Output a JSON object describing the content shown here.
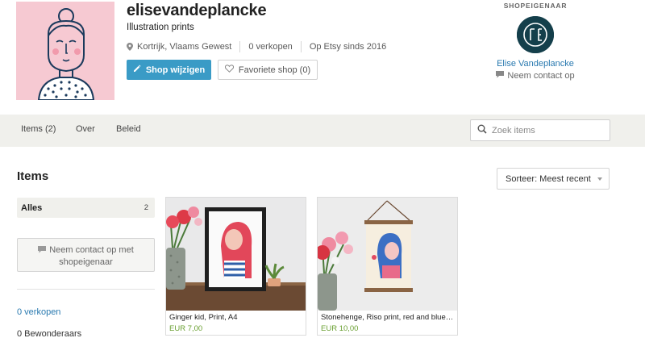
{
  "shop": {
    "name": "elisevandeplancke",
    "tagline": "Illustration prints",
    "location": "Kortrijk, Vlaams Gewest",
    "sales": "0 verkopen",
    "since": "Op Etsy sinds 2016",
    "edit_button": "Shop wijzigen",
    "favorite_button": "Favoriete shop (0)"
  },
  "owner": {
    "label": "SHOPEIGENAAR",
    "name": "Elise Vandeplancke",
    "contact": "Neem contact op"
  },
  "nav": {
    "tabs": [
      "Items (2)",
      "Over",
      "Beleid"
    ],
    "search_placeholder": "Zoek items"
  },
  "main": {
    "heading": "Items",
    "sort_label": "Sorteer: Meest recent",
    "filter_all": {
      "label": "Alles",
      "count": "2"
    },
    "contact_owner": "Neem contact op met shopeigenaar",
    "sales_link": "0 verkopen",
    "admirers": "0 Bewonderaars"
  },
  "listings": [
    {
      "title": "Ginger kid, Print, A4",
      "price": "EUR 7,00"
    },
    {
      "title": "Stonehenge, Riso print, red and blue illustration",
      "price": "EUR 10,00"
    }
  ],
  "colors": {
    "accent_blue": "#3a9bc6",
    "link_blue": "#2a7ab0",
    "price_green": "#6aa032",
    "nav_bg": "#f0f0ec",
    "logo_pink": "#f6c9d2"
  }
}
